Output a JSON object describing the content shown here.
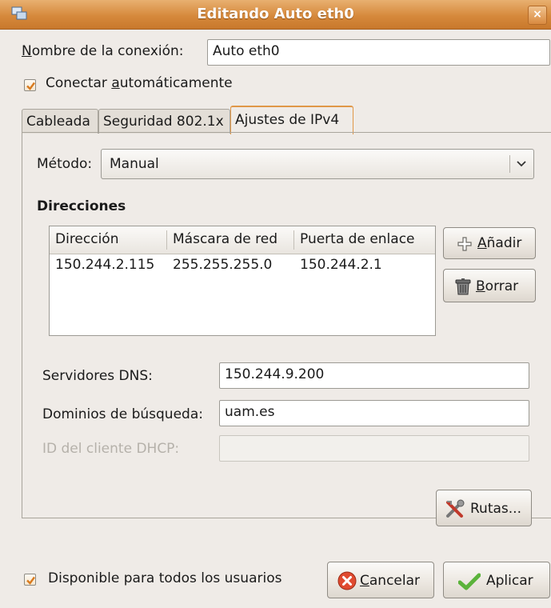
{
  "window": {
    "title": "Editando Auto eth0",
    "close_glyph": "×",
    "icon": "network-icon"
  },
  "connection": {
    "name_label_u": "N",
    "name_label_rest": "ombre de la conexión:",
    "name_value": "Auto eth0"
  },
  "autoconnect": {
    "label_pre": "Conectar ",
    "label_u": "a",
    "label_post": "utomáticamente",
    "checked": true
  },
  "tabs": [
    {
      "label": "Cableada"
    },
    {
      "label": "Seguridad 802.1x"
    },
    {
      "label": "Ajustes de IPv4",
      "active": true
    }
  ],
  "ipv4": {
    "method_label": "Método:",
    "method_value": "Manual",
    "addresses_title": "Direcciones",
    "columns": [
      "Dirección",
      "Máscara de red",
      "Puerta de enlace"
    ],
    "rows": [
      {
        "address": "150.244.2.115",
        "netmask": "255.255.255.0",
        "gateway": "150.244.2.1"
      }
    ],
    "add_u": "A",
    "add_rest": "ñadir",
    "delete_u": "B",
    "delete_rest": "orrar",
    "dns_label": "Servidores DNS:",
    "dns_value": "150.244.9.200",
    "search_label": "Dominios de búsqueda:",
    "search_value": "uam.es",
    "dhcp_label": "ID del cliente DHCP:",
    "dhcp_value": "",
    "routes_label": "Rutas..."
  },
  "footer": {
    "all_users_label": "Disponible para todos los usuarios",
    "all_users_checked": true,
    "cancel_u": "C",
    "cancel_rest": "ancelar",
    "apply_label": "Aplicar"
  },
  "colors": {
    "title_orange": "#d6893c",
    "tab_highlight": "#e09748",
    "cancel_red": "#e04a2f",
    "apply_green": "#5bb33b"
  }
}
